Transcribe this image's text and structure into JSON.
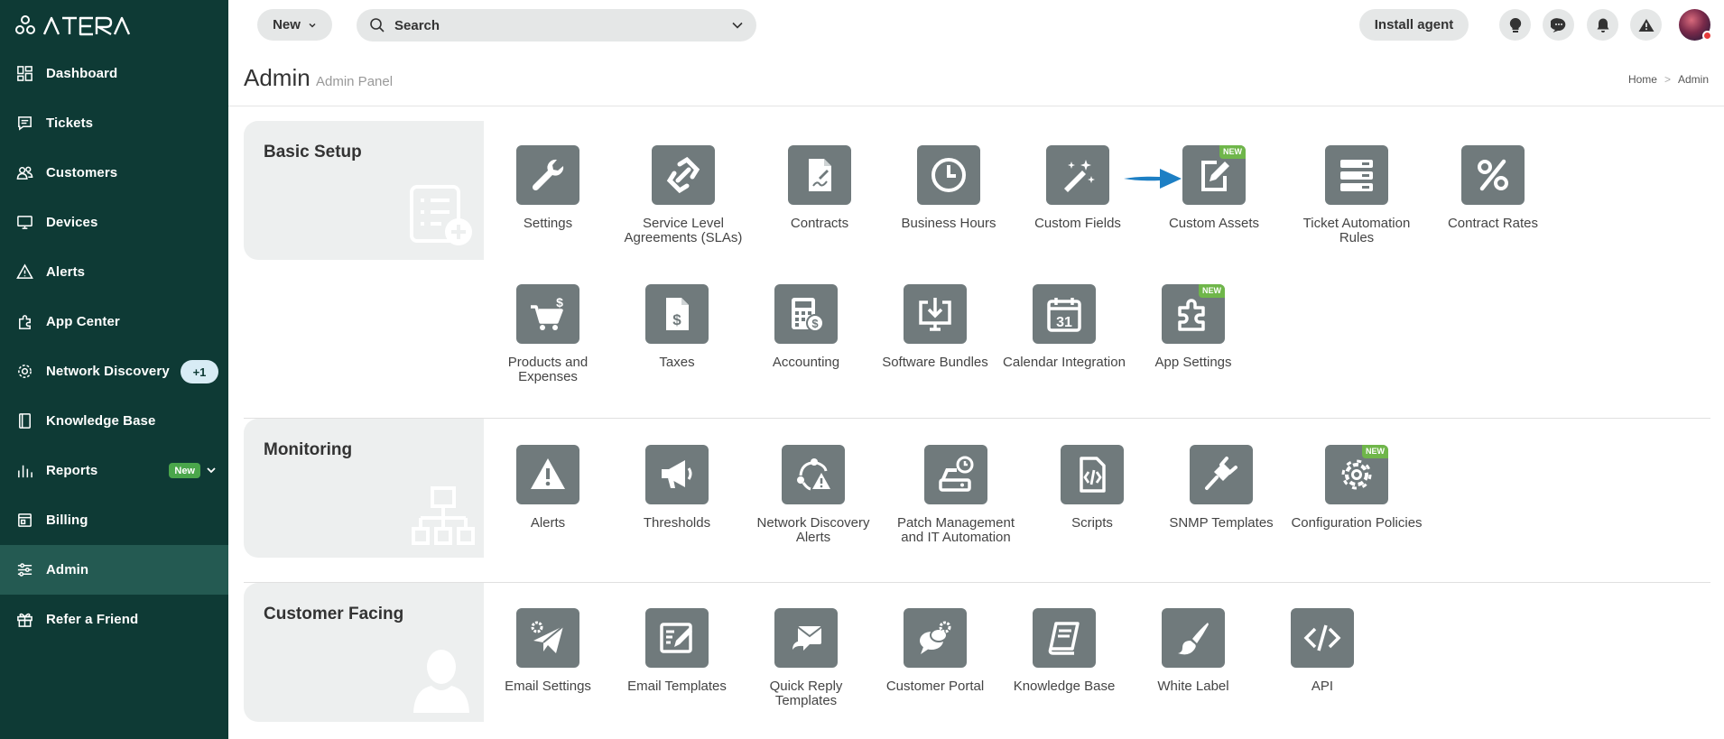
{
  "app": {
    "brand": "ATERA"
  },
  "sidebar": {
    "items": [
      {
        "label": "Dashboard",
        "icon": "dashboard-icon"
      },
      {
        "label": "Tickets",
        "icon": "tickets-icon"
      },
      {
        "label": "Customers",
        "icon": "customers-icon"
      },
      {
        "label": "Devices",
        "icon": "devices-icon"
      },
      {
        "label": "Alerts",
        "icon": "alerts-icon"
      },
      {
        "label": "App Center",
        "icon": "app-center-icon"
      },
      {
        "label": "Network Discovery",
        "icon": "network-discovery-icon",
        "count": "+1"
      },
      {
        "label": "Knowledge Base",
        "icon": "knowledge-base-icon"
      },
      {
        "label": "Reports",
        "icon": "reports-icon",
        "badge": "New"
      },
      {
        "label": "Billing",
        "icon": "billing-icon"
      },
      {
        "label": "Admin",
        "icon": "admin-icon",
        "active": true
      },
      {
        "label": "Refer a Friend",
        "icon": "gift-icon"
      }
    ]
  },
  "topbar": {
    "new_label": "New",
    "search_placeholder": "Search",
    "install_label": "Install agent",
    "icons": [
      "lightbulb-icon",
      "chat-icon",
      "bell-icon",
      "warning-icon"
    ]
  },
  "header": {
    "title": "Admin",
    "subtitle": "Admin Panel",
    "breadcrumb": {
      "home": "Home",
      "sep": ">",
      "current": "Admin"
    }
  },
  "sections": {
    "basic": {
      "title": "Basic Setup",
      "tiles": [
        {
          "label": "Settings",
          "icon": "wrench-icon"
        },
        {
          "label": "Service Level Agreements (SLAs)",
          "icon": "sla-icon"
        },
        {
          "label": "Contracts",
          "icon": "contract-icon"
        },
        {
          "label": "Business Hours",
          "icon": "clock-icon"
        },
        {
          "label": "Custom Fields",
          "icon": "magic-wand-icon"
        },
        {
          "label": "Custom Assets",
          "icon": "custom-assets-icon",
          "badge": "NEW"
        },
        {
          "label": "Ticket Automation Rules",
          "icon": "automation-rules-icon"
        },
        {
          "label": "Contract Rates",
          "icon": "percent-icon"
        },
        {
          "label": "Products and Expenses",
          "icon": "cart-icon"
        },
        {
          "label": "Taxes",
          "icon": "tax-document-icon"
        },
        {
          "label": "Accounting",
          "icon": "calculator-icon"
        },
        {
          "label": "Software Bundles",
          "icon": "software-download-icon"
        },
        {
          "label": "Calendar Integration",
          "icon": "calendar-icon",
          "day": "31"
        },
        {
          "label": "App Settings",
          "icon": "puzzle-icon",
          "badge": "NEW"
        }
      ]
    },
    "monitoring": {
      "title": "Monitoring",
      "tiles": [
        {
          "label": "Alerts",
          "icon": "alert-triangle-icon"
        },
        {
          "label": "Thresholds",
          "icon": "megaphone-icon"
        },
        {
          "label": "Network Discovery Alerts",
          "icon": "network-alert-icon"
        },
        {
          "label": "Patch Management and IT Automation",
          "icon": "patch-icon"
        },
        {
          "label": "Scripts",
          "icon": "script-icon"
        },
        {
          "label": "SNMP Templates",
          "icon": "plug-icon"
        },
        {
          "label": "Configuration Policies",
          "icon": "config-gear-icon",
          "badge": "NEW"
        }
      ]
    },
    "customer": {
      "title": "Customer Facing",
      "tiles": [
        {
          "label": "Email Settings",
          "icon": "email-settings-icon"
        },
        {
          "label": "Email Templates",
          "icon": "email-templates-icon"
        },
        {
          "label": "Quick Reply Templates",
          "icon": "quick-reply-icon"
        },
        {
          "label": "Customer Portal",
          "icon": "customer-portal-icon"
        },
        {
          "label": "Knowledge Base",
          "icon": "book-icon"
        },
        {
          "label": "White Label",
          "icon": "brush-icon"
        },
        {
          "label": "API",
          "icon": "code-icon"
        }
      ]
    }
  },
  "colors": {
    "sidebar": "#0e3a35",
    "active": "#245a52",
    "tile": "#707a7c",
    "badge": "#6fb64a",
    "arrow": "#1d7fc4"
  }
}
